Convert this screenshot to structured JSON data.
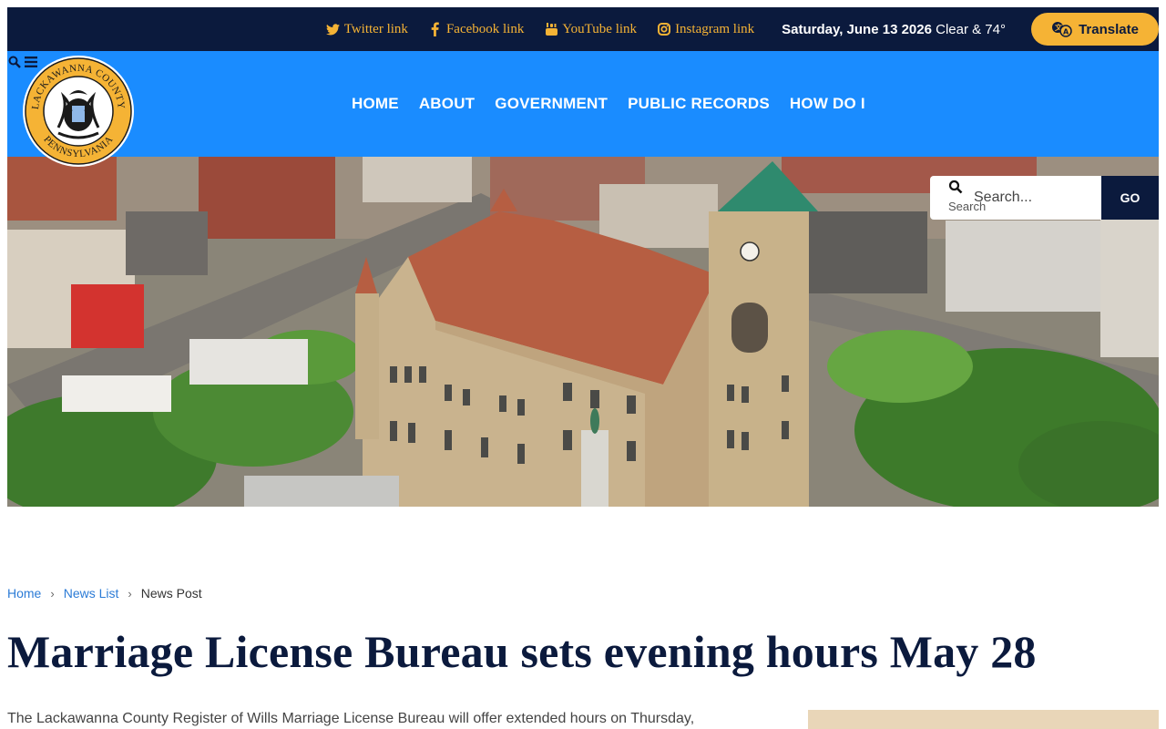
{
  "topbar": {
    "social_links": [
      {
        "label": "Twitter link",
        "icon": "twitter-icon"
      },
      {
        "label": "Facebook link",
        "icon": "facebook-icon"
      },
      {
        "label": "YouTube link",
        "icon": "youtube-icon"
      },
      {
        "label": "Instagram link",
        "icon": "instagram-icon"
      }
    ],
    "date": "Saturday, June 13 2026",
    "weather": "Clear & 74°",
    "translate_label": "Translate",
    "colors": {
      "background": "#0b1a3d",
      "accent": "#f5b335"
    }
  },
  "nav": {
    "items": [
      "HOME",
      "ABOUT",
      "GOVERNMENT",
      "PUBLIC RECORDS",
      "HOW DO I"
    ],
    "background": "#1a8cff",
    "logo": {
      "top_text": "LACKAWANNA COUNTY",
      "bottom_text": "PENNSYLVANIA"
    }
  },
  "search": {
    "label": "Search",
    "placeholder": "Search...",
    "button": "GO"
  },
  "breadcrumb": {
    "items": [
      "Home",
      "News List"
    ],
    "current": "News Post"
  },
  "article": {
    "title": "Marriage License Bureau sets evening hours May 28",
    "lead": "The Lackawanna County Register of Wills Marriage License Bureau will offer extended hours on Thursday,"
  }
}
